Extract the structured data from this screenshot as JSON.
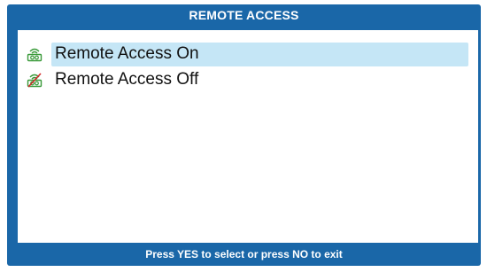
{
  "header": {
    "title": "REMOTE ACCESS"
  },
  "menu": {
    "items": [
      {
        "label": "Remote Access On",
        "icon": "remote-access-on-icon",
        "selected": true
      },
      {
        "label": "Remote Access Off",
        "icon": "remote-access-off-icon",
        "selected": false
      }
    ]
  },
  "footer": {
    "hint": "Press YES to select or press NO to exit"
  },
  "colors": {
    "frame": "#1a67a8",
    "highlight": "#c5e6f6",
    "icon_green": "#3a9a3a",
    "icon_red": "#d22a2a"
  }
}
